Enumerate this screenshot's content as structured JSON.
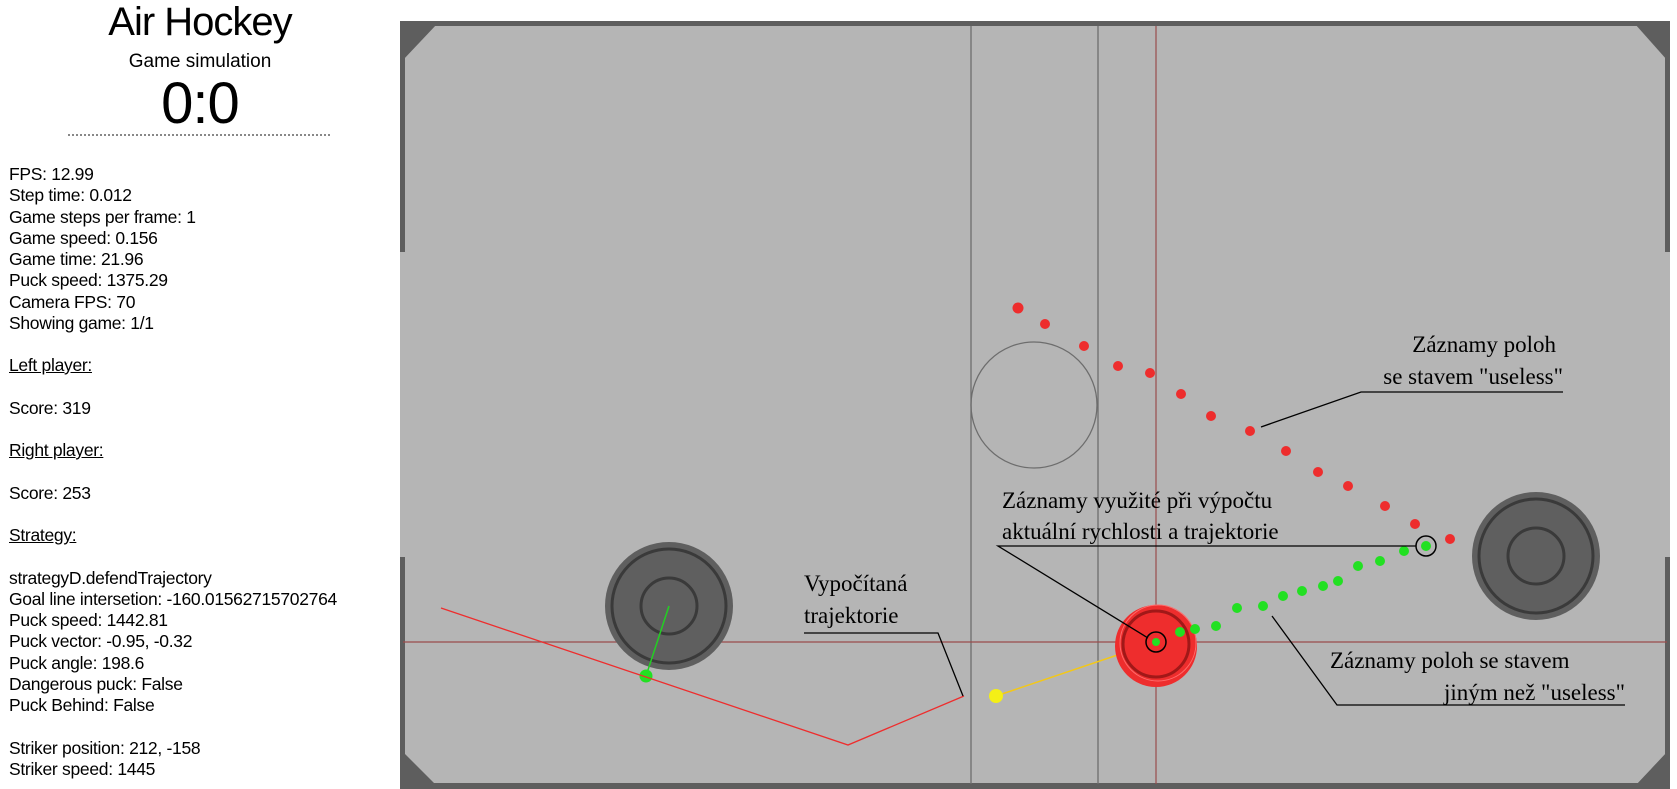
{
  "app": {
    "title": "Air Hockey",
    "subtitle": "Game simulation",
    "score": "0:0"
  },
  "stats": [
    "FPS: 12.99",
    "Step time: 0.012",
    "Game steps per frame: 1",
    "Game speed: 0.156",
    "Game time: 21.96",
    "Puck speed: 1375.29",
    "Camera FPS: 70",
    "Showing game: 1/1"
  ],
  "left_player": {
    "header": "Left player:",
    "score": "Score: 319"
  },
  "right_player": {
    "header": "Right player:",
    "score": "Score: 253"
  },
  "strategy": {
    "header": "Strategy:",
    "lines": [
      "strategyD.defendTrajectory",
      "Goal line intersetion: -160.01562715702764",
      "Puck speed: 1442.81",
      "Puck vector: -0.95, -0.32",
      "Puck angle: 198.6",
      "Dangerous puck: False",
      "Puck Behind: False"
    ]
  },
  "striker": {
    "position": "Striker position: 212, -158",
    "speed": "Striker speed:  1445"
  },
  "annotations": {
    "useless_line1": "Záznamy poloh",
    "useless_line2": "se stavem \"useless\"",
    "used_line1": "Záznamy využité při výpočtu",
    "used_line2": "aktuální rychlosti a trajektorie",
    "traj_line1": "Vypočítaná",
    "traj_line2": "trajektorie",
    "other_line1": "Záznamy poloh se stavem",
    "other_line2": "jiným než \"useless\""
  },
  "colors": {
    "table": "#b5b5b5",
    "border": "#5e5e5e",
    "striker": "#5f5f5f",
    "puck": "#ee2d2d",
    "useless_points": "#ee2d2d",
    "used_points": "#22e022",
    "trajectory": "#ee2d2d",
    "prediction": "#f4ef16"
  },
  "icons": {
    "left_striker": "striker-disc-icon",
    "right_striker": "striker-disc-icon",
    "puck": "puck-icon"
  }
}
